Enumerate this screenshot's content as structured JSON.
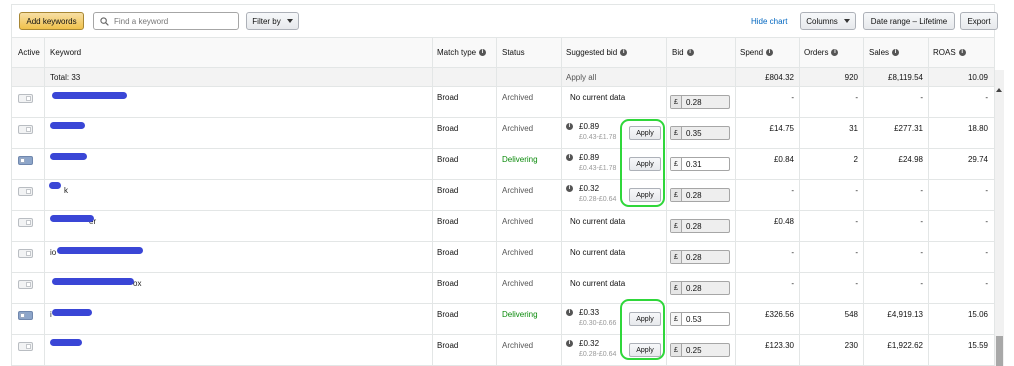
{
  "toolbar": {
    "add_keywords": "Add keywords",
    "search_placeholder": "Find a keyword",
    "filter_by": "Filter by",
    "hide_chart": "Hide chart",
    "columns": "Columns",
    "date_range": "Date range – Lifetime",
    "export": "Export"
  },
  "columns": {
    "active": "Active",
    "keyword": "Keyword",
    "match_type": "Match type",
    "status": "Status",
    "suggested_bid": "Suggested bid",
    "bid": "Bid",
    "spend": "Spend",
    "orders": "Orders",
    "sales": "Sales",
    "roas": "ROAS"
  },
  "totals": {
    "label": "Total: 33",
    "apply_all": "Apply all",
    "spend": "£804.32",
    "orders": "920",
    "sales": "£8,119.54",
    "roas": "10.09"
  },
  "currency": "£",
  "apply_label": "Apply",
  "colors": {
    "delivering": "#0a8a0a",
    "highlight": "#2fd73a",
    "redaction": "#3a46d6"
  },
  "rows": [
    {
      "keyword_visible": "",
      "active": false,
      "match": "Broad",
      "status": "Archived",
      "suggested": "No current data",
      "range": "",
      "bid": "0.28",
      "spend": "-",
      "orders": "-",
      "sales": "-",
      "roas": "-"
    },
    {
      "keyword_visible": "",
      "active": false,
      "match": "Broad",
      "status": "Archived",
      "suggested": "£0.89",
      "range": "£0.43-£1.78",
      "bid": "0.35",
      "spend": "£14.75",
      "orders": "31",
      "sales": "£277.31",
      "roas": "18.80"
    },
    {
      "keyword_visible": "",
      "active": true,
      "match": "Broad",
      "status": "Delivering",
      "suggested": "£0.89",
      "range": "£0.43-£1.78",
      "bid": "0.31",
      "spend": "£0.84",
      "orders": "2",
      "sales": "£24.98",
      "roas": "29.74"
    },
    {
      "keyword_visible": "k",
      "active": false,
      "match": "Broad",
      "status": "Archived",
      "suggested": "£0.32",
      "range": "£0.28-£0.64",
      "bid": "0.28",
      "spend": "-",
      "orders": "-",
      "sales": "-",
      "roas": "-"
    },
    {
      "keyword_visible": "er",
      "active": false,
      "match": "Broad",
      "status": "Archived",
      "suggested": "No current data",
      "range": "",
      "bid": "0.28",
      "spend": "£0.48",
      "orders": "-",
      "sales": "-",
      "roas": "-"
    },
    {
      "keyword_visible": "io",
      "active": false,
      "match": "Broad",
      "status": "Archived",
      "suggested": "No current data",
      "range": "",
      "bid": "0.28",
      "spend": "-",
      "orders": "-",
      "sales": "-",
      "roas": "-"
    },
    {
      "keyword_visible": "ox",
      "active": false,
      "match": "Broad",
      "status": "Archived",
      "suggested": "No current data",
      "range": "",
      "bid": "0.28",
      "spend": "-",
      "orders": "-",
      "sales": "-",
      "roas": "-"
    },
    {
      "keyword_visible": "i",
      "active": true,
      "match": "Broad",
      "status": "Delivering",
      "suggested": "£0.33",
      "range": "£0.30-£0.66",
      "bid": "0.53",
      "spend": "£326.56",
      "orders": "548",
      "sales": "£4,919.13",
      "roas": "15.06"
    },
    {
      "keyword_visible": "",
      "active": false,
      "match": "Broad",
      "status": "Archived",
      "suggested": "£0.32",
      "range": "£0.28-£0.64",
      "bid": "0.25",
      "spend": "£123.30",
      "orders": "230",
      "sales": "£1,922.62",
      "roas": "15.59"
    }
  ]
}
